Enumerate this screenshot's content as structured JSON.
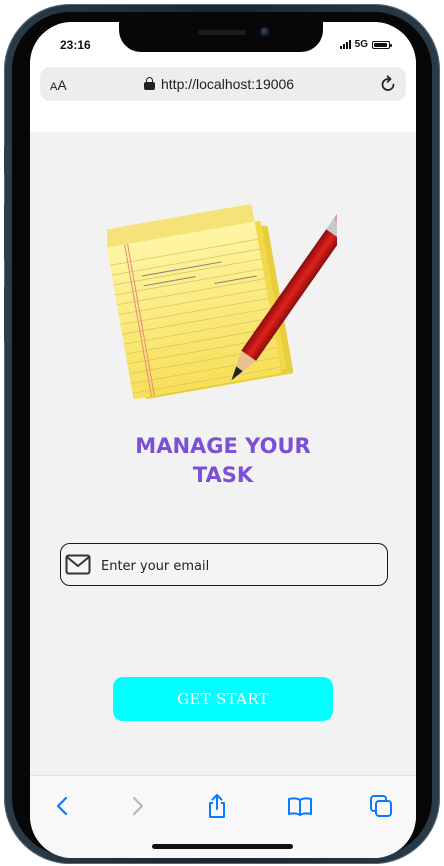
{
  "status_bar": {
    "time": "23:16",
    "network": "5G",
    "battery_level": 0.9
  },
  "browser": {
    "text_size_label": "AA",
    "url": "http://localhost:19006",
    "icons": [
      "lock-icon",
      "reload-icon"
    ]
  },
  "app": {
    "logo": "notepad-pencil-logo",
    "title_line1": "MANAGE YOUR",
    "title_line2": "TASK",
    "email_placeholder": "Enter your email",
    "email_value": "",
    "email_icon": "mail-icon",
    "start_button": "GET START",
    "colors": {
      "title": "#7b4fd6",
      "button": "#00ffff",
      "button_text": "#ffffff",
      "background": "#f2f2f2"
    }
  },
  "toolbar": {
    "items": [
      {
        "name": "back",
        "icon": "chevron-left-icon",
        "enabled": true
      },
      {
        "name": "forward",
        "icon": "chevron-right-icon",
        "enabled": false
      },
      {
        "name": "share",
        "icon": "share-icon",
        "enabled": true
      },
      {
        "name": "bookmarks",
        "icon": "book-icon",
        "enabled": true
      },
      {
        "name": "tabs",
        "icon": "tabs-icon",
        "enabled": true
      }
    ],
    "accent": "#0a7aff"
  }
}
